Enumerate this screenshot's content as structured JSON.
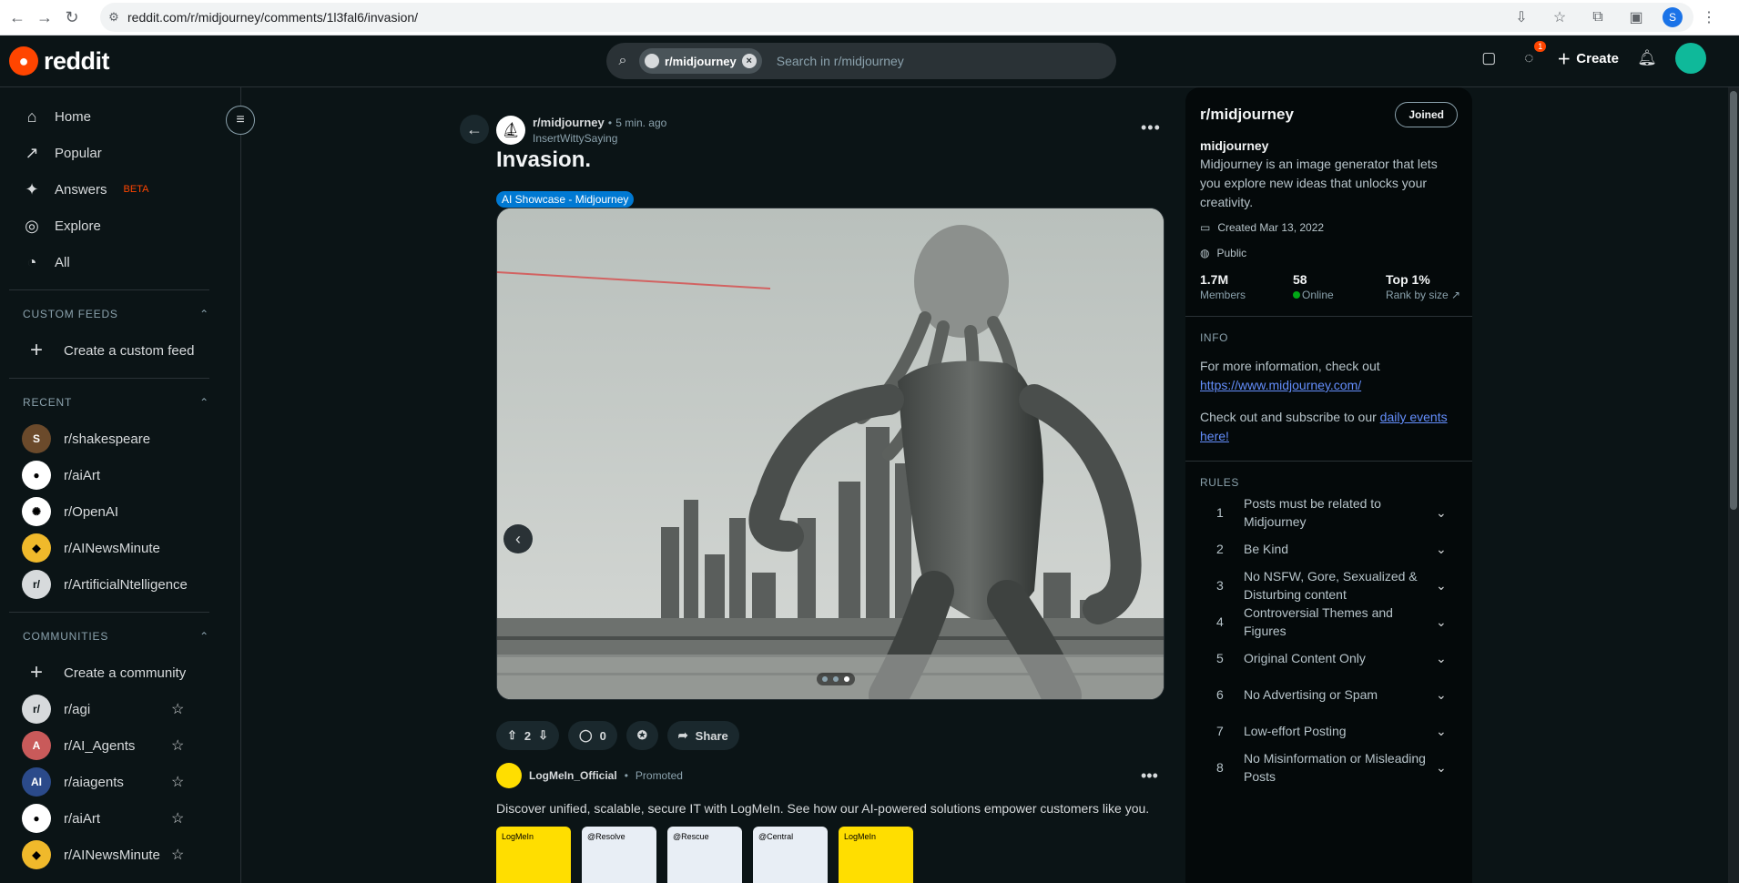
{
  "browser": {
    "url": "reddit.com/r/midjourney/comments/1l3fal6/invasion/",
    "profile_initial": "S"
  },
  "header": {
    "brand": "reddit",
    "search_chip": "r/midjourney",
    "search_placeholder": "Search in r/midjourney",
    "chat_badge": "1",
    "create_label": "Create"
  },
  "sidebar": {
    "nav": [
      {
        "label": "Home",
        "icon": "home-icon"
      },
      {
        "label": "Popular",
        "icon": "popular-icon"
      },
      {
        "label": "Answers",
        "icon": "answers-icon",
        "badge": "BETA"
      },
      {
        "label": "Explore",
        "icon": "explore-icon"
      },
      {
        "label": "All",
        "icon": "all-icon"
      }
    ],
    "custom_feeds_heading": "CUSTOM FEEDS",
    "create_feed": "Create a custom feed",
    "recent_heading": "RECENT",
    "recent": [
      "r/shakespeare",
      "r/aiArt",
      "r/OpenAI",
      "r/AINewsMinute",
      "r/ArtificialNtelligence"
    ],
    "communities_heading": "COMMUNITIES",
    "create_community": "Create a community",
    "communities": [
      "r/agi",
      "r/AI_Agents",
      "r/aiagents",
      "r/aiArt",
      "r/AINewsMinute"
    ]
  },
  "post": {
    "subreddit": "r/midjourney",
    "time": "5 min. ago",
    "author": "InsertWittySaying",
    "title": "Invasion.",
    "flair": "AI Showcase - Midjourney",
    "votes": "2",
    "comments": "0",
    "share_label": "Share"
  },
  "ad": {
    "advertiser": "LogMeIn_Official",
    "promoted": "Promoted",
    "text": "Discover unified, scalable, secure IT with LogMeIn. See how our AI-powered solutions empower customers like you.",
    "thumbs": [
      "LogMeIn",
      "@Resolve",
      "@Rescue",
      "@Central",
      "LogMeIn"
    ]
  },
  "community": {
    "title": "r/midjourney",
    "joined_label": "Joined",
    "name": "midjourney",
    "description": "Midjourney is an image generator that lets you explore new ideas that unlocks your creativity.",
    "created": "Created Mar 13, 2022",
    "visibility": "Public",
    "members_value": "1.7M",
    "members_label": "Members",
    "online_value": "58",
    "online_label": "Online",
    "rank_value": "Top 1%",
    "rank_label": "Rank by size",
    "info_heading": "INFO",
    "info_text": "For more information, check out",
    "info_link": "https://www.midjourney.com/",
    "events_text": "Check out and subscribe to our",
    "events_link": "daily events here!",
    "rules_heading": "RULES",
    "rules": [
      "Posts must be related to Midjourney",
      "Be Kind",
      "No NSFW, Gore, Sexualized & Disturbing content",
      "Controversial Themes and Figures",
      "Original Content Only",
      "No Advertising or Spam",
      "Low-effort Posting",
      "No Misinformation or Misleading Posts"
    ]
  },
  "colors": {
    "accent": "#ff4500",
    "background": "#0b1416",
    "flair": "#0079d3",
    "link": "#648efc"
  }
}
